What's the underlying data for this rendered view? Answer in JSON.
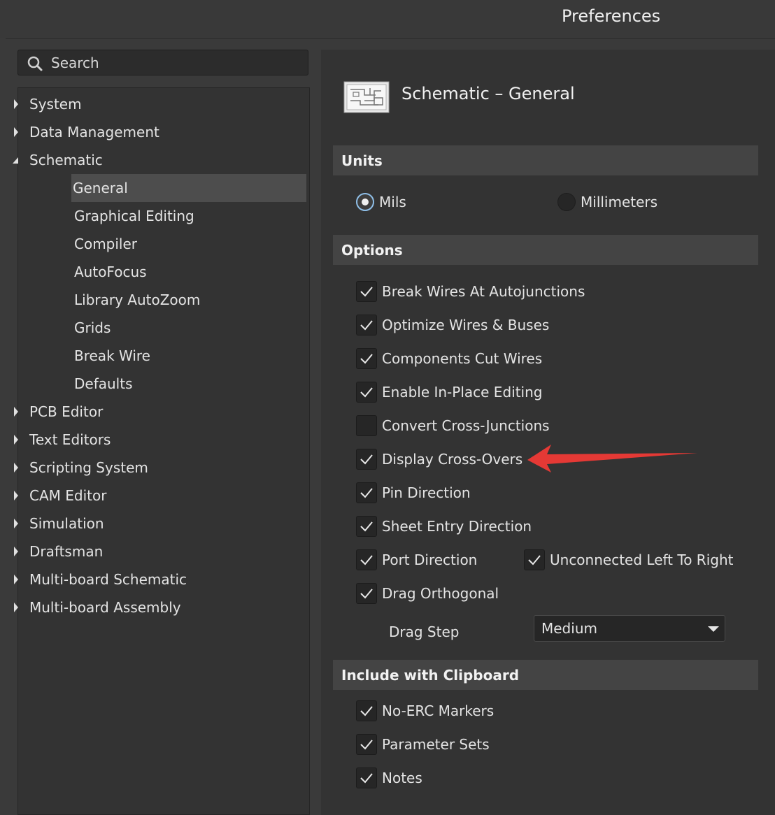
{
  "window": {
    "title": "Preferences"
  },
  "search": {
    "placeholder": "Search"
  },
  "tree": {
    "items": [
      {
        "label": "System"
      },
      {
        "label": "Data Management"
      },
      {
        "label": "Schematic"
      },
      {
        "label": "General"
      },
      {
        "label": "Graphical Editing"
      },
      {
        "label": "Compiler"
      },
      {
        "label": "AutoFocus"
      },
      {
        "label": "Library AutoZoom"
      },
      {
        "label": "Grids"
      },
      {
        "label": "Break Wire"
      },
      {
        "label": "Defaults"
      },
      {
        "label": "PCB Editor"
      },
      {
        "label": "Text Editors"
      },
      {
        "label": "Scripting System"
      },
      {
        "label": "CAM Editor"
      },
      {
        "label": "Simulation"
      },
      {
        "label": "Draftsman"
      },
      {
        "label": "Multi-board Schematic"
      },
      {
        "label": "Multi-board Assembly"
      }
    ]
  },
  "page": {
    "title": "Schematic – General"
  },
  "units": {
    "header": "Units",
    "options": [
      {
        "label": "Mils",
        "selected": true
      },
      {
        "label": "Millimeters",
        "selected": false
      }
    ]
  },
  "options": {
    "header": "Options",
    "items": [
      {
        "label": "Break Wires At Autojunctions",
        "checked": true
      },
      {
        "label": "Optimize Wires & Buses",
        "checked": true
      },
      {
        "label": "Components Cut Wires",
        "checked": true
      },
      {
        "label": "Enable In-Place Editing",
        "checked": true
      },
      {
        "label": "Convert Cross-Junctions",
        "checked": false
      },
      {
        "label": "Display Cross-Overs",
        "checked": true
      },
      {
        "label": "Pin Direction",
        "checked": true
      },
      {
        "label": "Sheet Entry Direction",
        "checked": true
      },
      {
        "label": "Port Direction",
        "checked": true
      },
      {
        "label": "Unconnected Left To Right",
        "checked": true
      },
      {
        "label": "Drag Orthogonal",
        "checked": true
      }
    ],
    "drag_step_label": "Drag Step",
    "drag_step_value": "Medium"
  },
  "clipboard": {
    "header": "Include with Clipboard",
    "items": [
      {
        "label": "No-ERC Markers",
        "checked": true
      },
      {
        "label": "Parameter Sets",
        "checked": true
      },
      {
        "label": "Notes",
        "checked": true
      }
    ]
  },
  "colors": {
    "annotation_arrow": "#e53935",
    "radio_focus": "#8fbfe8"
  }
}
